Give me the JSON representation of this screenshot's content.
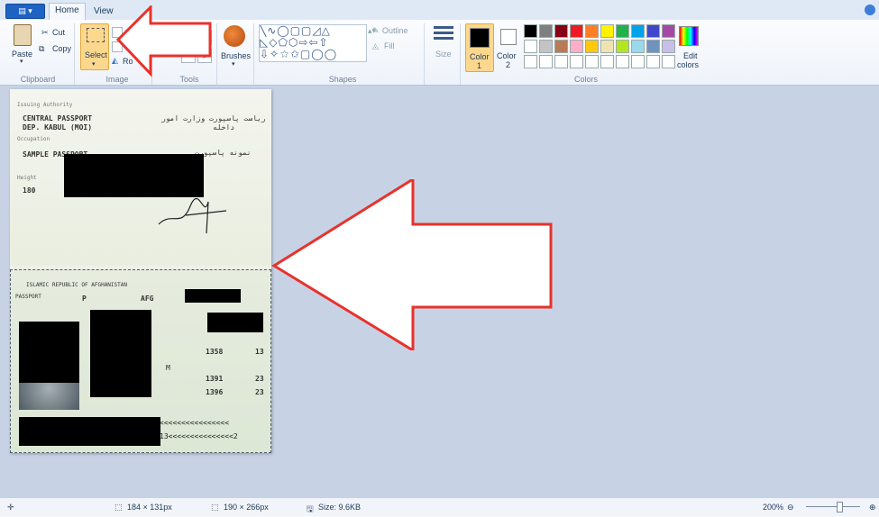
{
  "tabs": {
    "home": "Home",
    "view": "View"
  },
  "clipboard": {
    "paste": "Paste",
    "cut": "Cut",
    "copy": "Copy",
    "group": "Clipboard"
  },
  "image_group": {
    "select": "Select",
    "rotate": "Ro",
    "group": "Image"
  },
  "tools": {
    "brushes": "Brushes",
    "group": "Tools",
    "text_tool": "A"
  },
  "shapes": {
    "outline": "Outline",
    "fill": "Fill",
    "group": "Shapes",
    "glyphs": "╲∿◯▢▢◿△ ◺◇⬠⬡⇨⇦⇧ ⇩✧☆✩▢◯◯"
  },
  "size": {
    "label": "Size"
  },
  "colors": {
    "color1_a": "Color",
    "color1_b": "1",
    "color2_a": "Color",
    "color2_b": "2",
    "edit_a": "Edit",
    "edit_b": "colors",
    "group": "Colors",
    "palette": [
      "#000000",
      "#7f7f7f",
      "#880015",
      "#ed1c24",
      "#ff7f27",
      "#fff200",
      "#22b14c",
      "#00a2e8",
      "#3f48cc",
      "#a349a4",
      "#ffffff",
      "#c3c3c3",
      "#b97a57",
      "#ffaec9",
      "#ffc90e",
      "#efe4b0",
      "#b5e61d",
      "#99d9ea",
      "#7092be",
      "#c8bfe7",
      "#ffffff",
      "#ffffff",
      "#ffffff",
      "#ffffff",
      "#ffffff",
      "#ffffff",
      "#ffffff",
      "#ffffff",
      "#ffffff",
      "#ffffff"
    ]
  },
  "passport": {
    "top": {
      "issuing": "Issuing Authority",
      "line1": "CENTRAL PASSPORT",
      "line2": "DEP. KABUL (MOI)",
      "occupation": "Occupation",
      "sample": "SAMPLE PASSPORT",
      "height_label": "Height",
      "height": "180",
      "rtl1": "ریاست پاسپورت وزارت امور",
      "rtl2": "داخله",
      "rtl3": "نمونه پاسپورت"
    },
    "bottom": {
      "country": "ISLAMIC REPUBLIC OF AFGHANISTAN",
      "p": "P",
      "code": "AFG",
      "passport_label": "PASSPORT",
      "d1": "1358",
      "d1b": "13",
      "d2": "1391",
      "d2b": "23",
      "d3": "1396",
      "d3b": "23",
      "sex": "M",
      "mrz1": "<<<<<<<<<<<<<<<<",
      "mrz2": "13<<<<<<<<<<<<<<<2"
    }
  },
  "status": {
    "cursor": "184 × 131px",
    "selection": "190 × 266px",
    "size": "Size: 9.6KB",
    "zoom": "200%"
  }
}
